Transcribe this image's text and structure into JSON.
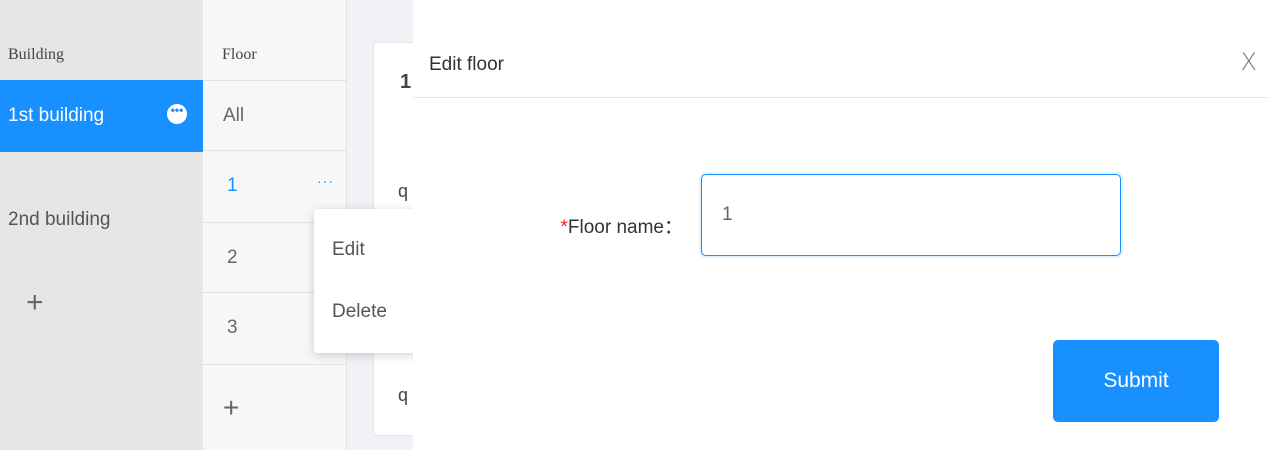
{
  "building_panel": {
    "header": "Building",
    "items": [
      {
        "label": "1st building",
        "more_icon": "•••"
      },
      {
        "label": "2nd building"
      }
    ],
    "add_icon": "+"
  },
  "floor_panel": {
    "header": "Floor",
    "items": [
      {
        "label": "All"
      },
      {
        "label": "1",
        "more_icon": "···"
      },
      {
        "label": "2"
      },
      {
        "label": "3"
      }
    ],
    "add_icon": "+"
  },
  "background_content": {
    "title_peek": "1",
    "row1_peek": "q",
    "row2_peek": "q"
  },
  "dropdown_menu": {
    "items": [
      "Edit",
      "Delete"
    ]
  },
  "modal": {
    "title": "Edit floor",
    "close_label": "X",
    "field": {
      "required_mark": "*",
      "label": "Floor name：",
      "value": "1"
    },
    "submit_label": "Submit"
  },
  "colors": {
    "accent": "#1890ff",
    "required": "#f5222d"
  }
}
